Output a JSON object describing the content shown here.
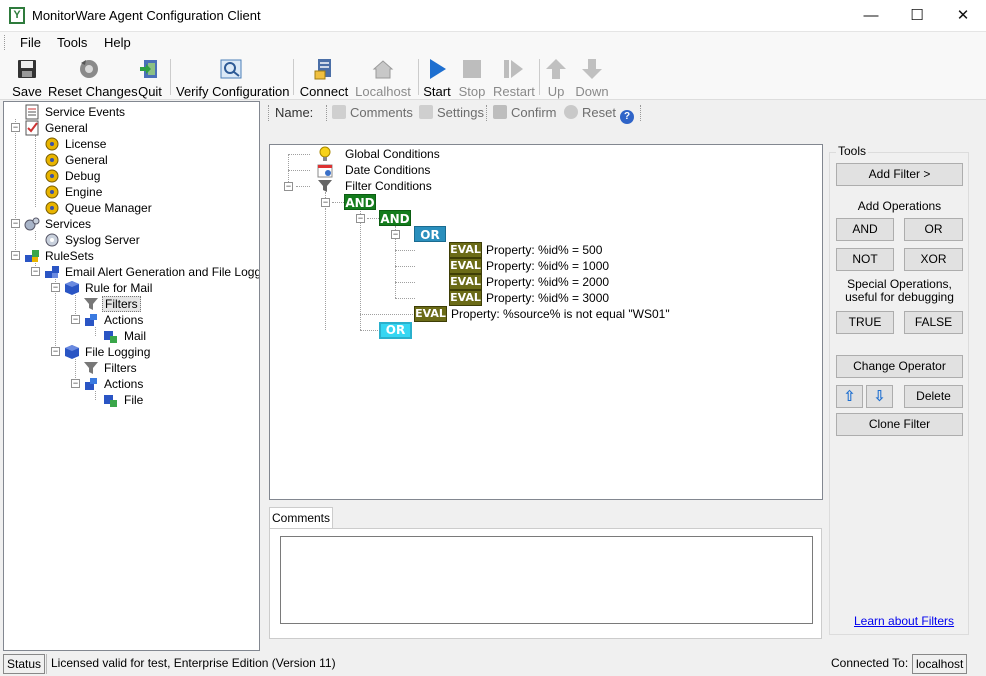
{
  "window": {
    "title": "MonitorWare Agent Configuration Client",
    "app_icon_glyph": "Y",
    "minimize_glyph": "—",
    "maximize_glyph": "☐",
    "close_glyph": "✕"
  },
  "menu": [
    "File",
    "Tools",
    "Help"
  ],
  "toolbar": {
    "save": "Save",
    "reset_changes": "Reset Changes",
    "quit": "Quit",
    "verify_configuration": "Verify Configuration",
    "connect": "Connect",
    "localhost": "Localhost",
    "start": "Start",
    "stop": "Stop",
    "restart": "Restart",
    "up": "Up",
    "down": "Down"
  },
  "tree": {
    "service_events": "Service Events",
    "general": "General",
    "license": "License",
    "general_child": "General",
    "debug": "Debug",
    "engine": "Engine",
    "queue_manager": "Queue Manager",
    "services": "Services",
    "syslog_server": "Syslog Server",
    "rulesets": "RuleSets",
    "email_alert": "Email Alert Generation and File Logging",
    "rule_for_mail": "Rule for Mail",
    "filters": "Filters",
    "actions": "Actions",
    "mail": "Mail",
    "file_logging": "File Logging",
    "filters2": "Filters",
    "actions2": "Actions",
    "file": "File"
  },
  "subtoolbar": {
    "name_label": "Name:",
    "comments": "Comments",
    "settings": "Settings",
    "confirm": "Confirm",
    "reset": "Reset",
    "help_glyph": "?"
  },
  "filter_tree": {
    "global_conditions": "Global Conditions",
    "date_conditions": "Date Conditions",
    "filter_conditions": "Filter Conditions",
    "and1": "AND",
    "and2": "AND",
    "or1": "OR",
    "eval_label": "EVAL",
    "eval1": "Property: %id% = 500",
    "eval2": "Property: %id% = 1000",
    "eval3": "Property: %id% = 2000",
    "eval4": "Property: %id% = 3000",
    "eval5": "Property: %source% is not equal \"WS01\"",
    "or2": "OR"
  },
  "comments": {
    "tab_label": "Comments",
    "value": ""
  },
  "tools": {
    "legend": "Tools",
    "add_filter": "Add Filter >",
    "add_operations": "Add Operations",
    "and": "AND",
    "or": "OR",
    "not": "NOT",
    "xor": "XOR",
    "special_operations": "Special Operations,\nuseful for debugging",
    "true": "TRUE",
    "false": "FALSE",
    "change_operator": "Change Operator",
    "up_glyph": "⇧",
    "down_glyph": "⇩",
    "delete": "Delete",
    "clone_filter": "Clone Filter",
    "learn_link": "Learn about Filters"
  },
  "status": {
    "status_label": "Status",
    "license_text": "Licensed valid for test, Enterprise Edition (Version 11)",
    "connected_to_label": "Connected To:",
    "connected_host": "localhost"
  },
  "colors": {
    "and_green": "#137b1c",
    "or_blue": "#2a8fbd",
    "or_selected": "#36d6f2",
    "eval_olive": "#6b6b17",
    "link_blue": "#0000ee"
  }
}
